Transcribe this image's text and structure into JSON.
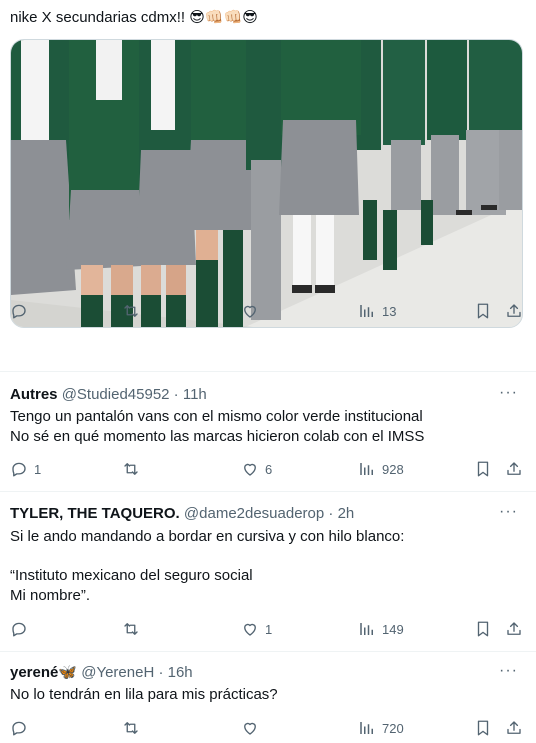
{
  "tweet": {
    "text": "nike X secundarias cdmx!! 😎👊🏻👊🏻😎",
    "media_alt": "photo of students in green school uniforms",
    "stats": {
      "replies": "",
      "retweets": "",
      "likes": "",
      "views": "13"
    }
  },
  "replies": [
    {
      "name": "Autres",
      "handle": "@Studied45952",
      "time": "11h",
      "lines": [
        "Tengo un pantalón vans con el mismo color verde institucional",
        "No sé en qué momento las marcas hicieron colab con el IMSS"
      ],
      "stats": {
        "replies": "1",
        "retweets": "",
        "likes": "6",
        "views": "928"
      }
    },
    {
      "name": "TYLER, THE TAQUERO.",
      "handle": "@dame2desuaderop",
      "time": "2h",
      "lines": [
        "Si le ando mandando a bordar en cursiva y con hilo blanco:",
        "",
        "“Instituto mexicano del seguro social",
        "Mi nombre”."
      ],
      "stats": {
        "replies": "",
        "retweets": "",
        "likes": "1",
        "views": "149"
      }
    },
    {
      "name": "yerené🦋",
      "handle": "@YereneH",
      "time": "16h",
      "lines": [
        "No lo tendrán en lila para mis prácticas?"
      ],
      "stats": {
        "replies": "",
        "retweets": "",
        "likes": "",
        "views": "720"
      }
    }
  ],
  "ui": {
    "more": "···",
    "dot": "·"
  },
  "colors": {
    "text": "#0f1419",
    "muted": "#536471",
    "divider": "#eff3f4",
    "uniform_green": "#1f5a3f",
    "skirt_gray": "#8d9095"
  }
}
